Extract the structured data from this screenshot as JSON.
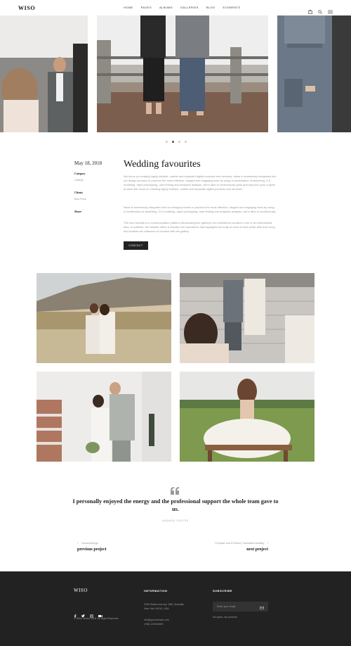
{
  "header": {
    "logo": "WISO",
    "nav": [
      "HOME",
      "PAGES",
      "ALBUMS",
      "GALLERIES",
      "BLOG",
      "ELEMENTS"
    ],
    "icons": [
      "cart-icon",
      "search-icon",
      "menu-icon"
    ]
  },
  "slider": {
    "dots": 4,
    "active_dot": 1
  },
  "project": {
    "date": "May 18, 2018",
    "category_label": "Category",
    "category_value": "Lifestyle",
    "clients_label": "Clients",
    "clients_value": "Biba Fonts",
    "share_label": "Share",
    "title": "Wedding favourites",
    "para1": "We focus on creating highly intuitive, usable and impactful digital products and services. Ideas is seamlessly integrated into our design process to produce the most effective, elegant and engaging work by using a combination of sketching, 3-D modeling, rapid prototyping, user testing and analytics analysis, we're able to continuously grow and improve upon a given product.We focus on creating highly intuitive, usable and impactful digital products and services.",
    "para2": "Ideas is seamlessly integrated into our design process to produce the most effective, elegant and engaging work by using a combination of sketching, 3-D modeling, rapid prototyping, user testing and analytics analysis, we're able to continuously.",
    "para3": "The new website is a communication platform showcasing the gallery's rich exhibitions curated in one or at international fairs. In addition, the website offers a visually rich experience that highlights the body of work of each artist, tells their story, and enables art collectors to connect with the gallery.",
    "contact_label": "CONTACT"
  },
  "quote": {
    "text": "I personally enjoyed the energy and the professional support the whole team gave to us.",
    "author": "AMANDA CARTER"
  },
  "pagination": {
    "prev_sub": "Casual feelings",
    "prev_label": "previous project",
    "next_sub": "Proposal: Ana & Robert | Fabricated wedding",
    "next_label": "next project"
  },
  "footer": {
    "logo": "WISO",
    "copyright": "© Wiso Studio 2018. All Right Reserved.",
    "info_head": "INFORMATION",
    "address1": "2005 Stokes Isle Apt. 896, Venaville,",
    "address2": "New York 10010, USA",
    "email": "info@yourdomain.com",
    "phone": "(+68) 120034509",
    "sub_head": "SUBSCRIBE",
    "email_placeholder": "Enter your email",
    "spam": "No spam, we promise"
  }
}
